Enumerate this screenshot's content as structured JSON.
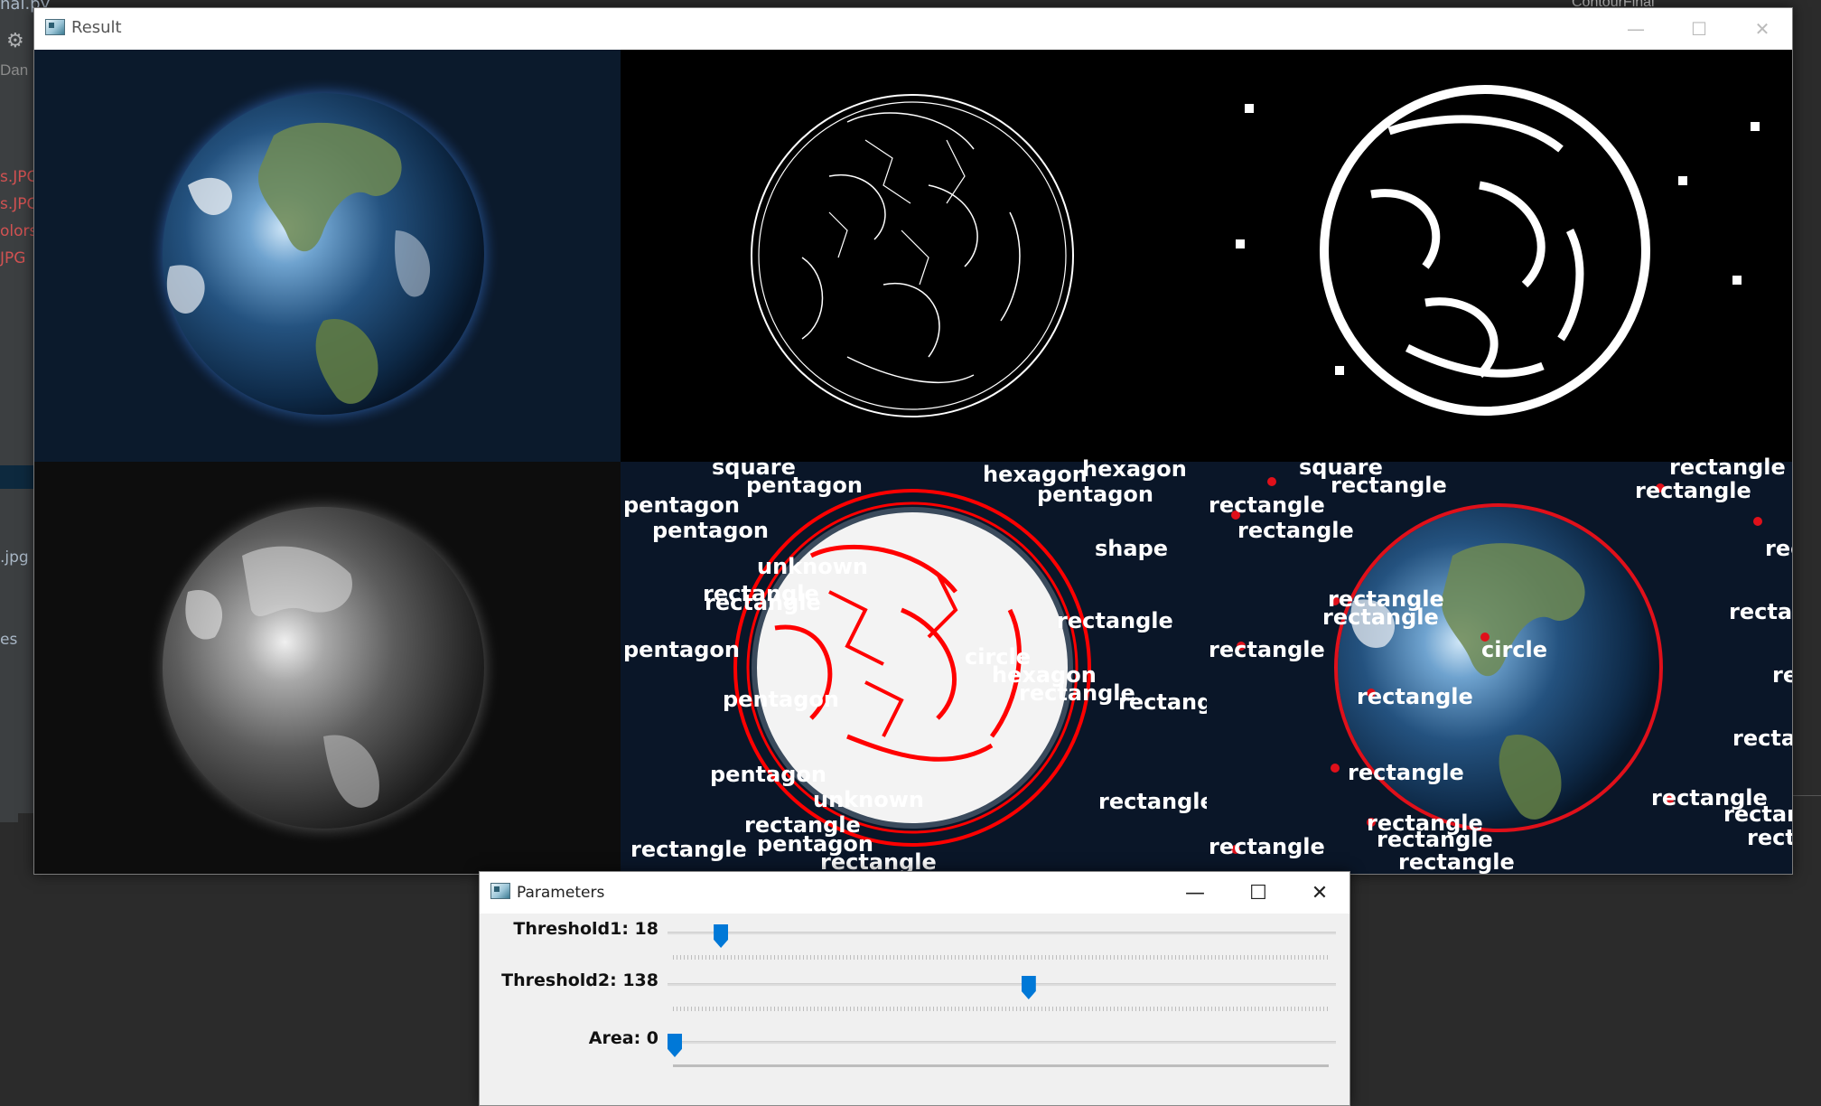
{
  "ide": {
    "tab_fragment": "nal.py",
    "user_fragment": "Dan",
    "right_tab": "ContourFinal",
    "files": [
      {
        "text": "s.JPG"
      },
      {
        "text": "s.JPG"
      },
      {
        "text": "olors_"
      },
      {
        "text": "JPG"
      },
      {
        "text": ".jpg"
      },
      {
        "text": "es"
      }
    ]
  },
  "result_window": {
    "title": "Result",
    "minimize_label": "—",
    "maximize_label": "☐",
    "close_label": "✕"
  },
  "panels": {
    "bottom_middle_labels": [
      "square",
      "pentagon",
      "pentagon",
      "pentagon",
      "hexagon",
      "pentagon",
      "hexagon",
      "rectangle",
      "unknown",
      "rectangle",
      "pentagon",
      "circle",
      "pentagon",
      "hexagon",
      "unknown",
      "rectangle",
      "pentagon",
      "rectangle",
      "pentagon",
      "rectangle",
      "shape",
      "rectangle",
      "rectangle",
      "rectangle",
      "rectangle"
    ],
    "bottom_right_labels": [
      "square",
      "rectangle",
      "rectangle",
      "rectangle",
      "rectangle",
      "rectangle",
      "rectangle",
      "rectangle",
      "circle",
      "rectangle",
      "rectangle",
      "rectangle",
      "rectangle",
      "rectangle",
      "rectangle",
      "rectangle",
      "rectangle",
      "rectangle",
      "rectangle",
      "rectangle",
      "rectangle",
      "rectangle",
      "rectangle"
    ]
  },
  "params_window": {
    "title": "Parameters",
    "minimize_label": "—",
    "maximize_label": "☐",
    "close_label": "✕",
    "sliders": [
      {
        "label": "Threshold1: 18",
        "value": 18,
        "max": 255
      },
      {
        "label": "Threshold2: 138",
        "value": 138,
        "max": 255
      },
      {
        "label": "Area: 0",
        "value": 0,
        "max": 30000
      }
    ]
  },
  "colors": {
    "accent": "#0078d7",
    "contour_red": "#ff0000",
    "ide_background": "#2b2b2b"
  }
}
